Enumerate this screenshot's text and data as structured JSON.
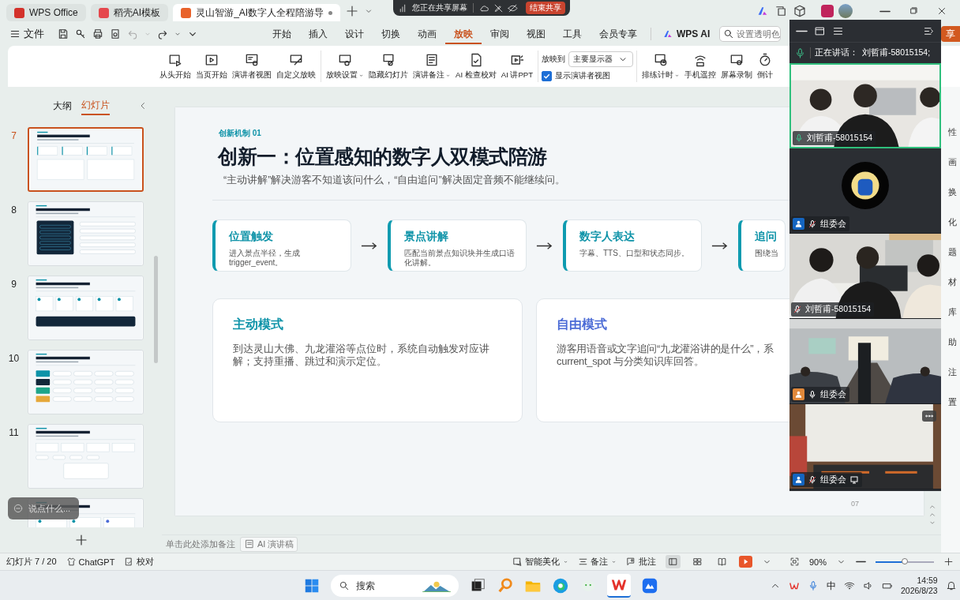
{
  "title_bar": {
    "tabs": [
      {
        "label": "WPS Office",
        "kind": "wps",
        "selected": false
      },
      {
        "label": "稻壳AI模板",
        "kind": "docer",
        "selected": false
      },
      {
        "label": "灵山智游_AI数字人全程陪游导",
        "kind": "presentation",
        "selected": true,
        "unsaved": true
      }
    ]
  },
  "share_bar": {
    "status": "您正在共享屏幕",
    "stop_button": "结束共享"
  },
  "menu_bar": {
    "file": "文件",
    "tabs": [
      {
        "label": "开始",
        "selected": false
      },
      {
        "label": "插入",
        "selected": false
      },
      {
        "label": "设计",
        "selected": false
      },
      {
        "label": "切换",
        "selected": false
      },
      {
        "label": "动画",
        "selected": false
      },
      {
        "label": "放映",
        "selected": true
      },
      {
        "label": "审阅",
        "selected": false
      },
      {
        "label": "视图",
        "selected": false
      },
      {
        "label": "工具",
        "selected": false
      },
      {
        "label": "会员专享",
        "selected": false
      }
    ],
    "ai_button": "WPS AI",
    "search": {
      "placeholder": "设置透明色"
    },
    "share_button": "享"
  },
  "ribbon": {
    "groups": [
      {
        "buttons": [
          {
            "label": "从头开始",
            "caret": false
          },
          {
            "label": "当页开始",
            "caret": false
          },
          {
            "label": "演讲者视图",
            "caret": false
          },
          {
            "label": "自定义放映",
            "caret": false
          }
        ]
      },
      {
        "buttons": [
          {
            "label": "放映设置",
            "caret": true
          },
          {
            "label": "隐藏幻灯片",
            "caret": false
          },
          {
            "label": "演讲备注",
            "caret": true
          },
          {
            "label": "AI 检查校对",
            "caret": false
          },
          {
            "label": "AI 讲PPT",
            "caret": false
          }
        ]
      }
    ],
    "play_to": {
      "label": "放映到",
      "value": "主要显示器"
    },
    "presenter_view": {
      "label": "显示演讲者视图",
      "checked": true
    },
    "tools": [
      {
        "label": "排练计时",
        "caret": true
      },
      {
        "label": "手机遥控",
        "caret": false
      },
      {
        "label": "屏幕录制",
        "caret": false
      },
      {
        "label": "倒计",
        "caret": false
      }
    ]
  },
  "sidebar": {
    "tabs": [
      {
        "label": "大纲",
        "selected": false
      },
      {
        "label": "幻灯片",
        "selected": true
      }
    ],
    "slides": [
      {
        "number": "7",
        "selected": true,
        "kind": "flow"
      },
      {
        "number": "8",
        "selected": false,
        "kind": "console"
      },
      {
        "number": "9",
        "selected": false,
        "kind": "steps"
      },
      {
        "number": "10",
        "selected": false,
        "kind": "matrix"
      },
      {
        "number": "11",
        "selected": false,
        "kind": "metrics"
      },
      {
        "selected": false,
        "kind": "cards"
      }
    ],
    "chat_hint": "说点什么..."
  },
  "slide": {
    "kicker": "创新机制 01",
    "title": "创新一：位置感知的数字人双模式陪游",
    "subtitle": "“主动讲解”解决游客不知道该问什么，“自由追问”解决固定音频不能继续问。",
    "steps": [
      {
        "title": "位置触发",
        "text": "进入景点半径，生成 trigger_event。"
      },
      {
        "title": "景点讲解",
        "text": "匹配当前景点知识块并生成口语化讲解。"
      },
      {
        "title": "数字人表达",
        "text": "字幕、TTS、口型和状态同步。"
      },
      {
        "title": "追问",
        "text": "围绕当"
      }
    ],
    "modes": [
      {
        "title": "主动模式",
        "kind": "active",
        "lines": [
          "到达灵山大佛、九龙灌浴等点位时，系统自动触发对应讲解；支持重播、跳过和演示定位。"
        ]
      },
      {
        "title": "自由模式",
        "kind": "free",
        "lines": [
          "游客用语音或文字追问“九龙灌浴讲的是什么”，系",
          "current_spot 与分类知识库回答。"
        ]
      }
    ],
    "page_number": "07"
  },
  "notes": {
    "placeholder": "单击此处添加备注",
    "ai_button": "AI 演讲稿"
  },
  "status_bar": {
    "slide_count": "幻灯片 7 / 20",
    "left_items": [
      "ChatGPT",
      "校对"
    ],
    "right_items": [
      {
        "label": "智能美化",
        "caret": true
      },
      {
        "label": "备注",
        "caret": true
      },
      {
        "label": "批注",
        "caret": false
      }
    ],
    "views": [
      {
        "selected": true
      },
      {
        "selected": false
      },
      {
        "selected": false
      }
    ],
    "zoom": "90%",
    "zoom_slider": {
      "level": 0.5
    }
  },
  "meeting": {
    "speaking_label": "正在讲话：",
    "speaker": "刘哲甫-58015154;",
    "tiles": [
      {
        "name": "刘哲甫-58015154",
        "kind": "video",
        "muted": false,
        "speaking": true,
        "highlighted": true
      },
      {
        "name": "组委会",
        "kind": "avatar",
        "muted": true,
        "speaking": false,
        "color": "#1565c0",
        "highlighted": false
      },
      {
        "name": "刘哲甫-58015154",
        "kind": "video",
        "muted": true,
        "speaking": false,
        "highlighted": false
      },
      {
        "name": "组委会",
        "kind": "video",
        "muted": false,
        "speaking": false,
        "color": "#e0883a",
        "highlighted": false
      },
      {
        "name": "组委会",
        "kind": "video",
        "muted": true,
        "speaking": false,
        "color": "#1565c0",
        "sharing": true,
        "highlighted": false
      }
    ]
  },
  "side_panel": {
    "labels": [
      "性",
      "画",
      "换",
      "化",
      "题",
      "材",
      "库",
      "助",
      "注",
      "置"
    ]
  },
  "taskbar": {
    "search_placeholder": "搜索",
    "ime": "中",
    "time": "14:59",
    "date": "2026/8/23"
  }
}
